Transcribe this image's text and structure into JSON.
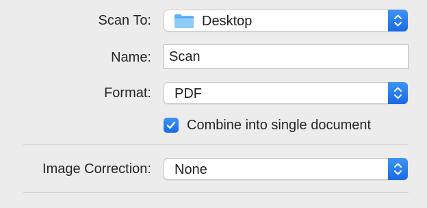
{
  "scan_to": {
    "label": "Scan To:",
    "value": "Desktop",
    "icon": "folder-icon"
  },
  "name": {
    "label": "Name:",
    "value": "Scan"
  },
  "format": {
    "label": "Format:",
    "value": "PDF"
  },
  "combine": {
    "label": "Combine into single document",
    "checked": true
  },
  "image_correction": {
    "label": "Image Correction:",
    "value": "None"
  },
  "colors": {
    "accent": "#1a6ae6",
    "background": "#ececec"
  }
}
